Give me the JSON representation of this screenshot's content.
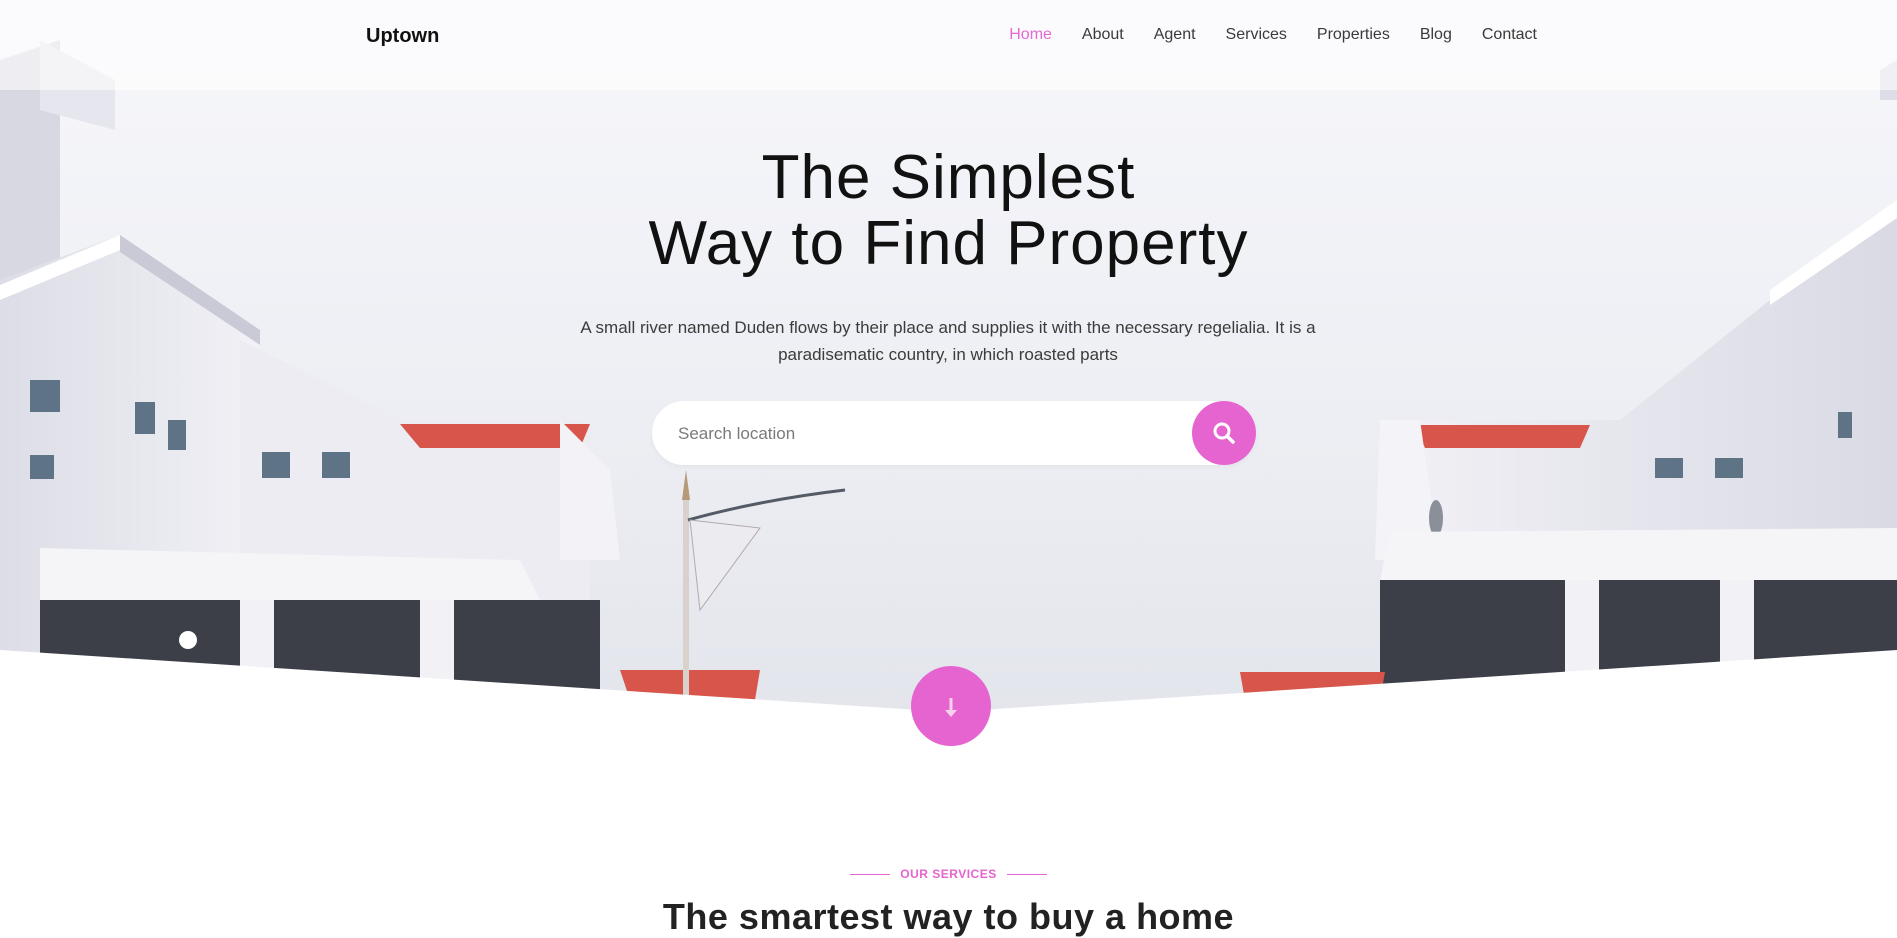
{
  "nav": {
    "brand": "Uptown",
    "items": [
      {
        "label": "Home",
        "active": true
      },
      {
        "label": "About",
        "active": false
      },
      {
        "label": "Agent",
        "active": false
      },
      {
        "label": "Services",
        "active": false
      },
      {
        "label": "Properties",
        "active": false
      },
      {
        "label": "Blog",
        "active": false
      },
      {
        "label": "Contact",
        "active": false
      }
    ]
  },
  "hero": {
    "title_line1": "The Simplest",
    "title_line2": "Way to Find Property",
    "subtitle": "A small river named Duden flows by their place and supplies it with the necessary regelialia. It is a paradisematic country, in which roasted parts",
    "search_placeholder": "Search location",
    "search_icon": "search-icon",
    "scroll_icon": "arrow-down-icon"
  },
  "services": {
    "label": "OUR SERVICES",
    "title": "The smartest way to buy a home"
  },
  "colors": {
    "accent": "#e664cf",
    "nav_active": "#e56ad0"
  }
}
